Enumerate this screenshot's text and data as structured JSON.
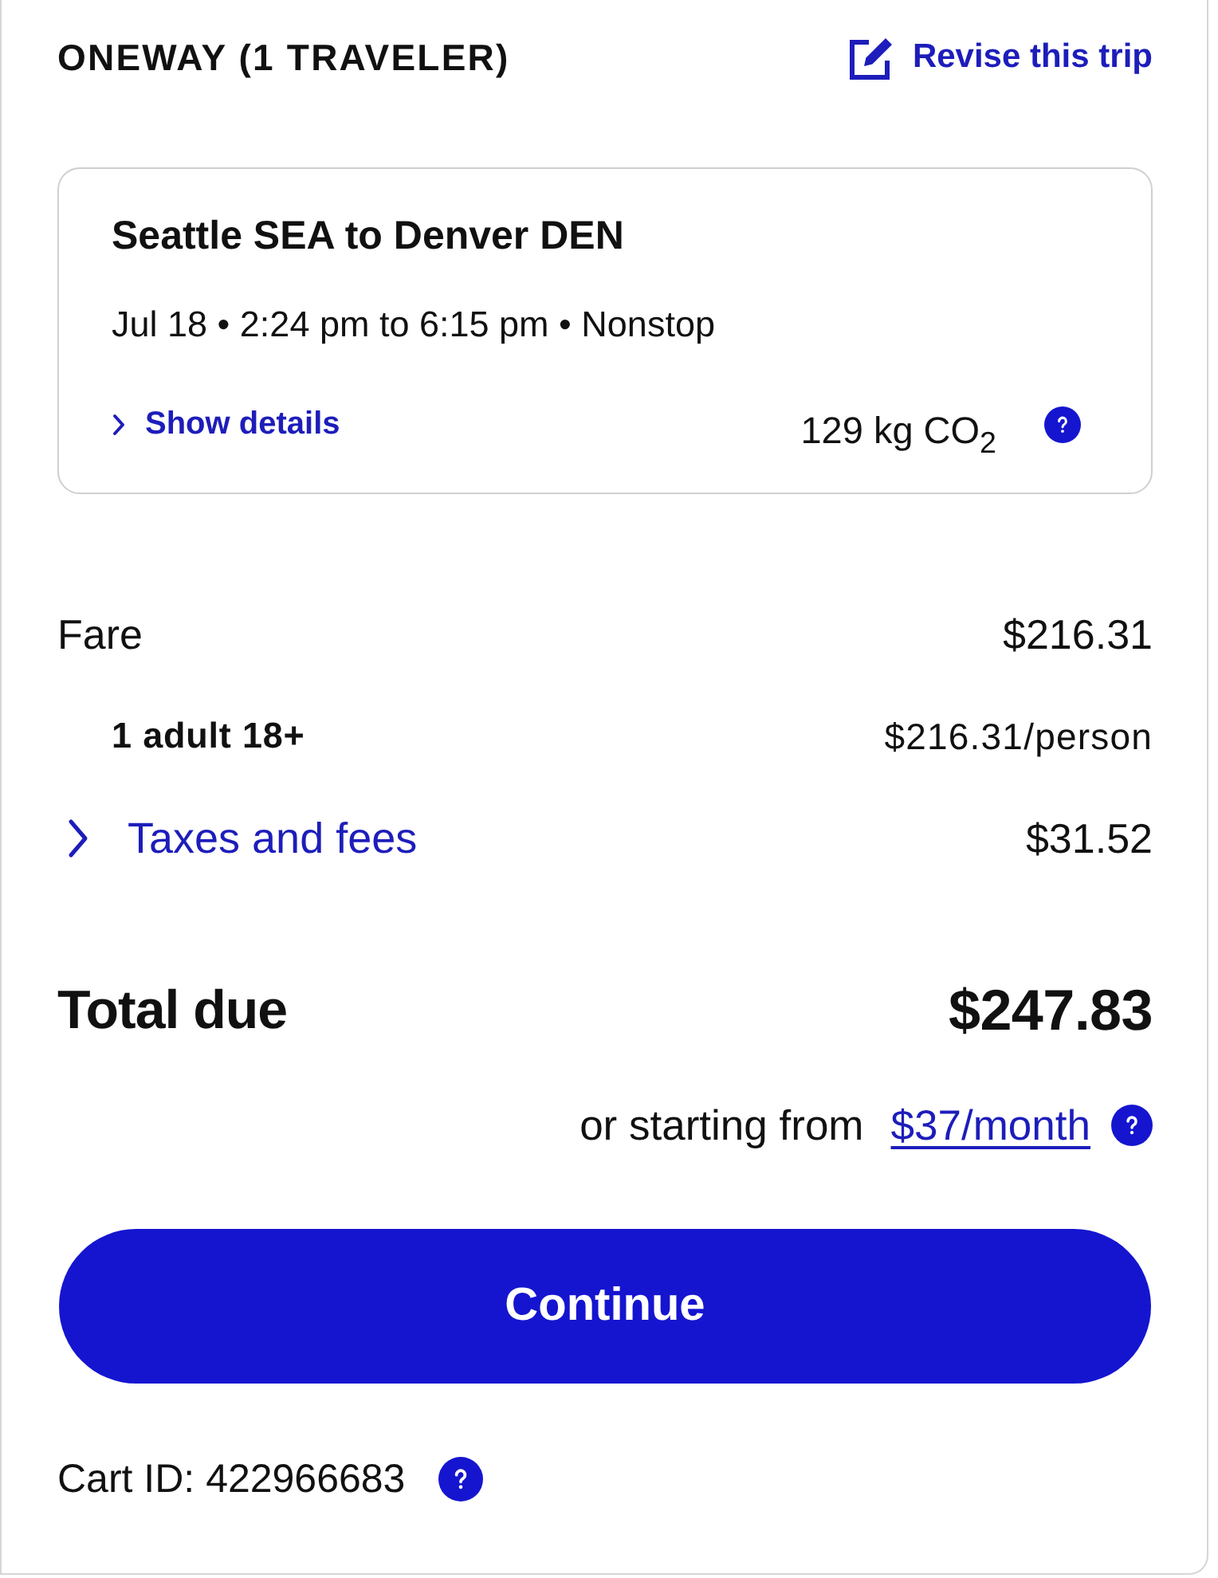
{
  "header": {
    "title": "ONEWAY (1 TRAVELER)",
    "revise_link": "Revise this trip"
  },
  "flight": {
    "route": "Seattle SEA to Denver DEN",
    "schedule": "Jul 18 • 2:24 pm to 6:15 pm • Nonstop",
    "details_link": "Show details",
    "expanded": false,
    "emissions": "129 kg CO$_{2}$"
  },
  "price_lines": [
    {
      "kind": "main",
      "label": "Fare",
      "amount": "$216.31"
    },
    {
      "kind": "sub",
      "label": "1 adult 18+",
      "amount": "$216.31/person"
    },
    {
      "kind": "expandable",
      "label": "Taxes and fees",
      "amount": "$31.52",
      "expanded": false
    }
  ],
  "total": {
    "label": "Total due",
    "amount": "$247.83"
  },
  "financing": {
    "text": "or starting from",
    "link": "$37/month"
  },
  "button": "Continue",
  "cart": {
    "text": "Cart ID: 422966683"
  }
}
